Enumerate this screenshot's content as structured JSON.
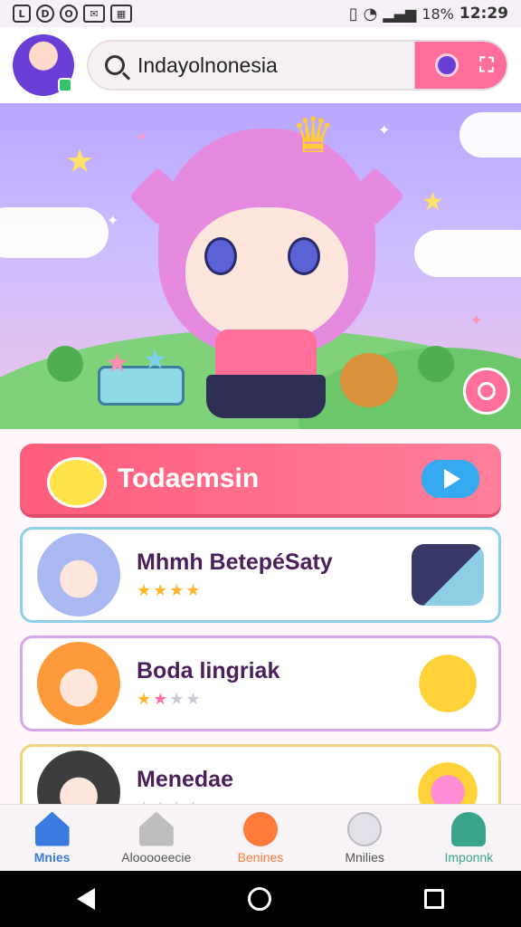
{
  "status_bar": {
    "time": "12:29",
    "battery": "18%",
    "left_icons": [
      "notification-icon",
      "notification-icon",
      "notification-icon",
      "mail-icon",
      "image-icon"
    ],
    "right_icons": [
      "vibrate-icon",
      "wifi-icon",
      "signal-icon"
    ]
  },
  "header": {
    "search_text": "Indayolnonesia",
    "search_icon": "search-icon",
    "avatar_icon": "profile-avatar"
  },
  "hero": {
    "fab_icon": "compass-icon"
  },
  "banner": {
    "title": "Todaemsin"
  },
  "cards": [
    {
      "title": "Mhmh BetepéSaty",
      "rating": 4,
      "max": 4,
      "accent": "#8fcfe6"
    },
    {
      "title": "Boda lingriak",
      "rating": 2,
      "max": 4,
      "accent": "#d6a7e6"
    },
    {
      "title": "Menedae",
      "rating": 0,
      "max": 4,
      "accent": "#f2d27a"
    }
  ],
  "bottom_nav": [
    {
      "label": "Mnies",
      "icon": "home-icon",
      "active": true
    },
    {
      "label": "Alooooeecie",
      "icon": "house-icon",
      "active": false
    },
    {
      "label": "Benines",
      "icon": "heart-icon",
      "active": false
    },
    {
      "label": "Mnilies",
      "icon": "bear-icon",
      "active": false
    },
    {
      "label": "Imponnk",
      "icon": "person-icon",
      "active": false
    }
  ],
  "colors": {
    "accent": "#ff6f9a",
    "banner": "#ff5d7c",
    "play": "#36aaf0",
    "nav_active": "#3b7be0",
    "nav_benines": "#ff7a3b",
    "nav_imponnk": "#3aa58a"
  }
}
